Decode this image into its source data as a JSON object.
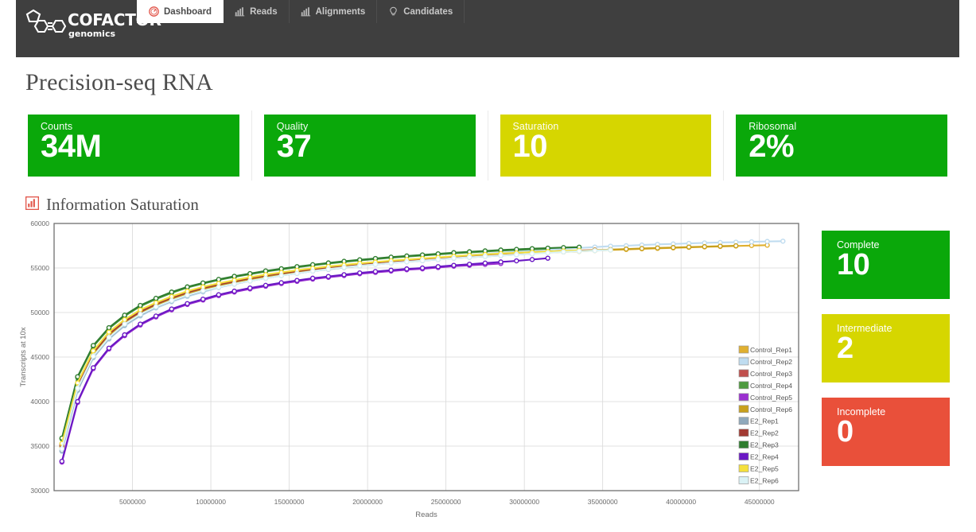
{
  "brand": {
    "name": "COFACTOR",
    "sub": "genomics",
    "logo_icon": "molecule-logo-icon"
  },
  "nav": {
    "tabs": [
      {
        "label": "Dashboard",
        "icon": "gauge-icon",
        "active": true
      },
      {
        "label": "Reads",
        "icon": "bar-chart-icon",
        "active": false
      },
      {
        "label": "Alignments",
        "icon": "bar-chart-icon",
        "active": false
      },
      {
        "label": "Candidates",
        "icon": "lightbulb-icon",
        "active": false
      }
    ]
  },
  "page": {
    "title": "Precision-seq RNA"
  },
  "stats": [
    {
      "label": "Counts",
      "value": "34M",
      "color": "#0aa80a"
    },
    {
      "label": "Quality",
      "value": "37",
      "color": "#0aa80a"
    },
    {
      "label": "Saturation",
      "value": "10",
      "color": "#d6d600"
    },
    {
      "label": "Ribosomal",
      "value": "2%",
      "color": "#0aa80a"
    }
  ],
  "section": {
    "title": "Information Saturation",
    "icon": "bar-chart-icon",
    "icon_color": "#e2574c"
  },
  "side_cards": [
    {
      "label": "Complete",
      "value": "10",
      "color": "#0aa80a"
    },
    {
      "label": "Intermediate",
      "value": "2",
      "color": "#d6d600"
    },
    {
      "label": "Incomplete",
      "value": "0",
      "color": "#e9503a"
    }
  ],
  "chart_data": {
    "type": "line",
    "title": "Information Saturation",
    "xlabel": "Reads",
    "ylabel": "Transcripts at 10x",
    "xlim": [
      0,
      47500000
    ],
    "ylim": [
      30000,
      60000
    ],
    "xticks": [
      5000000,
      10000000,
      15000000,
      20000000,
      25000000,
      30000000,
      35000000,
      40000000,
      45000000
    ],
    "xticklabels": [
      "5000000",
      "10000000",
      "15000000",
      "20000000",
      "25000000",
      "30000000",
      "35000000",
      "40000000",
      "45000000"
    ],
    "yticks": [
      30000,
      35000,
      40000,
      45000,
      50000,
      55000,
      60000
    ],
    "yticklabels": [
      "30000",
      "35000",
      "40000",
      "45000",
      "50000",
      "55000",
      "60000"
    ],
    "grid": true,
    "legend_position": "inside-right",
    "marker": "circle",
    "series": [
      {
        "name": "Control_Rep1",
        "color": "#e0b030",
        "x": [
          500000,
          1500000,
          2500000,
          3500000,
          4500000,
          5500000,
          6500000,
          7500000,
          8500000,
          9500000,
          10500000,
          11500000,
          12500000,
          13500000,
          14500000,
          15500000,
          16500000,
          17500000,
          18500000,
          19500000,
          20500000,
          21500000,
          22500000,
          23500000,
          24500000,
          25500000,
          26500000,
          27500000,
          28500000,
          29500000,
          30500000,
          31500000,
          32500000,
          33500000,
          34500000,
          35500000,
          36500000,
          37500000,
          38500000,
          39500000,
          40500000,
          41500000,
          42500000,
          43500000,
          44500000,
          45500000
        ],
        "y": [
          34900,
          41700,
          45300,
          47400,
          48800,
          49900,
          50800,
          51500,
          52100,
          52600,
          53000,
          53400,
          53700,
          54000,
          54300,
          54500,
          54800,
          55000,
          55200,
          55400,
          55500,
          55700,
          55800,
          55900,
          56000,
          56150,
          56250,
          56350,
          56450,
          56550,
          56650,
          56720,
          56800,
          56870,
          56950,
          57020,
          57080,
          57150,
          57200,
          57260,
          57320,
          57370,
          57420,
          57470,
          57520,
          57560
        ]
      },
      {
        "name": "Control_Rep2",
        "color": "#bfdcf0",
        "x": [
          500000,
          1500000,
          2500000,
          3500000,
          4500000,
          5500000,
          6500000,
          7500000,
          8500000,
          9500000,
          10500000,
          11500000,
          12500000,
          13500000,
          14500000,
          15500000,
          16500000,
          17500000,
          18500000,
          19500000,
          20500000,
          21500000,
          22500000,
          23500000,
          24500000,
          25500000,
          26500000,
          27500000,
          28500000,
          29500000,
          30500000,
          31500000,
          32500000,
          33500000,
          34500000,
          35500000,
          36500000,
          37500000,
          38500000,
          39500000,
          40500000,
          41500000,
          42500000,
          43500000,
          44500000,
          45500000,
          46500000
        ],
        "y": [
          34400,
          41200,
          44900,
          47000,
          48500,
          49600,
          50500,
          51200,
          51800,
          52300,
          52800,
          53200,
          53550,
          53850,
          54150,
          54400,
          54650,
          54900,
          55100,
          55300,
          55450,
          55650,
          55800,
          55950,
          56100,
          56300,
          56450,
          56600,
          56700,
          56850,
          56950,
          57050,
          57150,
          57250,
          57350,
          57450,
          57500,
          57580,
          57650,
          57700,
          57760,
          57820,
          57860,
          57900,
          57940,
          57980,
          58010
        ]
      },
      {
        "name": "Control_Rep3",
        "color": "#c0504d",
        "x": [
          500000,
          1500000,
          2500000,
          3500000,
          4500000,
          5500000,
          6500000,
          7500000,
          8500000,
          9500000,
          10500000,
          11500000,
          12500000,
          13500000,
          14500000,
          15500000,
          16500000,
          17500000,
          18500000,
          19500000,
          20500000,
          21500000,
          22500000,
          23500000,
          24500000,
          25500000,
          26500000,
          27500000,
          28500000,
          29500000,
          30500000,
          31500000,
          32500000,
          33500000,
          34500000
        ],
        "y": [
          35200,
          42000,
          45600,
          47700,
          49100,
          50200,
          51000,
          51700,
          52300,
          52800,
          53200,
          53550,
          53900,
          54200,
          54450,
          54700,
          54900,
          55100,
          55300,
          55450,
          55600,
          55750,
          55850,
          56000,
          56100,
          56250,
          56350,
          56450,
          56550,
          56650,
          56750,
          56820,
          56900,
          56960,
          57020
        ]
      },
      {
        "name": "Control_Rep4",
        "color": "#4e9a3f",
        "x": [
          500000,
          1500000,
          2500000,
          3500000,
          4500000,
          5500000,
          6500000,
          7500000,
          8500000,
          9500000,
          10500000,
          11500000,
          12500000,
          13500000,
          14500000,
          15500000,
          16500000,
          17500000,
          18500000,
          19500000,
          20500000,
          21500000,
          22500000,
          23500000,
          24500000,
          25500000,
          26500000,
          27500000,
          28500000,
          29500000,
          30500000,
          31500000
        ],
        "y": [
          35800,
          42700,
          46200,
          48200,
          49600,
          50700,
          51500,
          52200,
          52800,
          53250,
          53650,
          54000,
          54300,
          54600,
          54850,
          55080,
          55300,
          55500,
          55680,
          55850,
          56000,
          56150,
          56280,
          56400,
          56520,
          56650,
          56750,
          56850,
          56950,
          57020,
          57100,
          57160
        ]
      },
      {
        "name": "Control_Rep5",
        "color": "#9b30d0",
        "x": [
          500000,
          1500000,
          2500000,
          3500000,
          4500000,
          5500000,
          6500000,
          7500000,
          8500000,
          9500000,
          10500000,
          11500000,
          12500000,
          13500000,
          14500000,
          15500000,
          16500000,
          17500000,
          18500000,
          19500000,
          20500000,
          21500000,
          22500000,
          23500000,
          24500000,
          25500000,
          26500000,
          27500000,
          28500000
        ],
        "y": [
          33200,
          39900,
          43700,
          45900,
          47400,
          48600,
          49500,
          50300,
          50900,
          51400,
          51900,
          52300,
          52650,
          52950,
          53250,
          53500,
          53750,
          53950,
          54150,
          54350,
          54500,
          54650,
          54800,
          54900,
          55050,
          55200,
          55300,
          55400,
          55500
        ]
      },
      {
        "name": "Control_Rep6",
        "color": "#c8a01c",
        "x": [
          500000,
          1500000,
          2500000,
          3500000,
          4500000,
          5500000,
          6500000,
          7500000,
          8500000,
          9500000,
          10500000,
          11500000,
          12500000,
          13500000,
          14500000,
          15500000,
          16500000,
          17500000,
          18500000,
          19500000,
          20500000,
          21500000,
          22500000,
          23500000,
          24500000,
          25500000,
          26500000,
          27500000,
          28500000,
          29500000,
          30500000,
          31500000,
          32500000,
          33500000,
          34500000,
          35500000,
          36500000,
          37500000,
          38500000,
          39500000,
          40500000,
          41500000,
          42500000,
          43500000
        ],
        "y": [
          35000,
          41800,
          45400,
          47500,
          48900,
          50000,
          50850,
          51550,
          52150,
          52650,
          53050,
          53400,
          53750,
          54050,
          54300,
          54550,
          54800,
          55000,
          55200,
          55380,
          55530,
          55680,
          55820,
          55950,
          56060,
          56200,
          56300,
          56400,
          56500,
          56600,
          56700,
          56780,
          56850,
          56920,
          57000,
          57070,
          57130,
          57190,
          57250,
          57300,
          57350,
          57400,
          57450,
          57490
        ]
      },
      {
        "name": "E2_Rep1",
        "color": "#8fa9bc",
        "x": [
          500000,
          1500000,
          2500000,
          3500000,
          4500000,
          5500000,
          6500000,
          7500000,
          8500000,
          9500000,
          10500000,
          11500000,
          12500000,
          13500000,
          14500000,
          15500000,
          16500000,
          17500000,
          18500000,
          19500000,
          20500000,
          21500000,
          22500000,
          23500000,
          24500000,
          25500000,
          26500000,
          27500000,
          28500000,
          29500000,
          30500000
        ],
        "y": [
          34500,
          41300,
          45000,
          47100,
          48600,
          49700,
          50600,
          51300,
          51900,
          52400,
          52850,
          53200,
          53550,
          53850,
          54150,
          54400,
          54650,
          54850,
          55050,
          55250,
          55400,
          55550,
          55700,
          55820,
          55950,
          56100,
          56200,
          56300,
          56400,
          56500,
          56600
        ]
      },
      {
        "name": "E2_Rep2",
        "color": "#a23a33",
        "x": [
          500000,
          1500000,
          2500000,
          3500000,
          4500000,
          5500000,
          6500000,
          7500000,
          8500000,
          9500000,
          10500000,
          11500000,
          12500000,
          13500000,
          14500000,
          15500000,
          16500000,
          17500000,
          18500000,
          19500000,
          20500000,
          21500000,
          22500000,
          23500000,
          24500000,
          25500000,
          26500000,
          27500000,
          28500000,
          29500000,
          30500000,
          31500000,
          32500000
        ],
        "y": [
          35100,
          41900,
          45500,
          47600,
          49000,
          50100,
          50950,
          51650,
          52250,
          52750,
          53150,
          53500,
          53850,
          54150,
          54400,
          54650,
          54880,
          55080,
          55280,
          55450,
          55600,
          55750,
          55880,
          56000,
          56120,
          56260,
          56360,
          56470,
          56570,
          56670,
          56770,
          56840,
          56920
        ]
      },
      {
        "name": "E2_Rep3",
        "color": "#2f7d2f",
        "x": [
          500000,
          1500000,
          2500000,
          3500000,
          4500000,
          5500000,
          6500000,
          7500000,
          8500000,
          9500000,
          10500000,
          11500000,
          12500000,
          13500000,
          14500000,
          15500000,
          16500000,
          17500000,
          18500000,
          19500000,
          20500000,
          21500000,
          22500000,
          23500000,
          24500000,
          25500000,
          26500000,
          27500000,
          28500000,
          29500000,
          30500000,
          31500000,
          32500000,
          33500000
        ],
        "y": [
          35900,
          42800,
          46300,
          48300,
          49700,
          50800,
          51600,
          52300,
          52880,
          53320,
          53720,
          54070,
          54370,
          54670,
          54920,
          55150,
          55370,
          55570,
          55750,
          55920,
          56070,
          56220,
          56350,
          56470,
          56590,
          56720,
          56820,
          56920,
          57020,
          57090,
          57170,
          57230,
          57290,
          57340
        ]
      },
      {
        "name": "E2_Rep4",
        "color": "#6a18c4",
        "x": [
          500000,
          1500000,
          2500000,
          3500000,
          4500000,
          5500000,
          6500000,
          7500000,
          8500000,
          9500000,
          10500000,
          11500000,
          12500000,
          13500000,
          14500000,
          15500000,
          16500000,
          17500000,
          18500000,
          19500000,
          20500000,
          21500000,
          22500000,
          23500000,
          24500000,
          25500000,
          26500000,
          27500000,
          28500000,
          29500000,
          30500000,
          31500000
        ],
        "y": [
          33300,
          40000,
          43800,
          46000,
          47500,
          48700,
          49600,
          50400,
          51000,
          51500,
          52000,
          52400,
          52750,
          53050,
          53350,
          53600,
          53850,
          54050,
          54250,
          54450,
          54600,
          54750,
          54900,
          55000,
          55150,
          55300,
          55420,
          55550,
          55680,
          55800,
          55950,
          56100
        ]
      },
      {
        "name": "E2_Rep5",
        "color": "#f5e03c",
        "x": [
          500000,
          1500000,
          2500000,
          3500000,
          4500000,
          5500000,
          6500000,
          7500000,
          8500000,
          9500000,
          10500000,
          11500000,
          12500000,
          13500000,
          14500000,
          15500000,
          16500000,
          17500000,
          18500000,
          19500000,
          20500000,
          21500000,
          22500000,
          23500000,
          24500000,
          25500000,
          26500000,
          27500000,
          28500000,
          29500000,
          30500000,
          31500000,
          32500000,
          33500000
        ],
        "y": [
          35300,
          42100,
          45700,
          47800,
          49200,
          50300,
          51100,
          51800,
          52400,
          52880,
          53280,
          53630,
          53960,
          54260,
          54510,
          54750,
          54970,
          55170,
          55350,
          55520,
          55670,
          55820,
          55950,
          56070,
          56190,
          56320,
          56420,
          56520,
          56620,
          56700,
          56780,
          56850,
          56920,
          56980
        ]
      },
      {
        "name": "E2_Rep6",
        "color": "#daf2f5",
        "x": [
          500000,
          1500000,
          2500000,
          3500000,
          4500000,
          5500000,
          6500000,
          7500000,
          8500000,
          9500000,
          10500000,
          11500000,
          12500000,
          13500000,
          14500000,
          15500000,
          16500000,
          17500000,
          18500000,
          19500000,
          20500000,
          21500000,
          22500000,
          23500000,
          24500000,
          25500000,
          26500000,
          27500000,
          28500000,
          29500000,
          30500000,
          31500000,
          32500000,
          33500000,
          34500000,
          35500000
        ],
        "y": [
          34700,
          41500,
          45100,
          47200,
          48700,
          49800,
          50650,
          51350,
          51950,
          52450,
          52850,
          53220,
          53550,
          53850,
          54150,
          54400,
          54650,
          54870,
          55070,
          55250,
          55400,
          55550,
          55700,
          55830,
          55950,
          56100,
          56200,
          56300,
          56400,
          56500,
          56600,
          56700,
          56800,
          56880,
          56950,
          57020
        ]
      }
    ]
  }
}
